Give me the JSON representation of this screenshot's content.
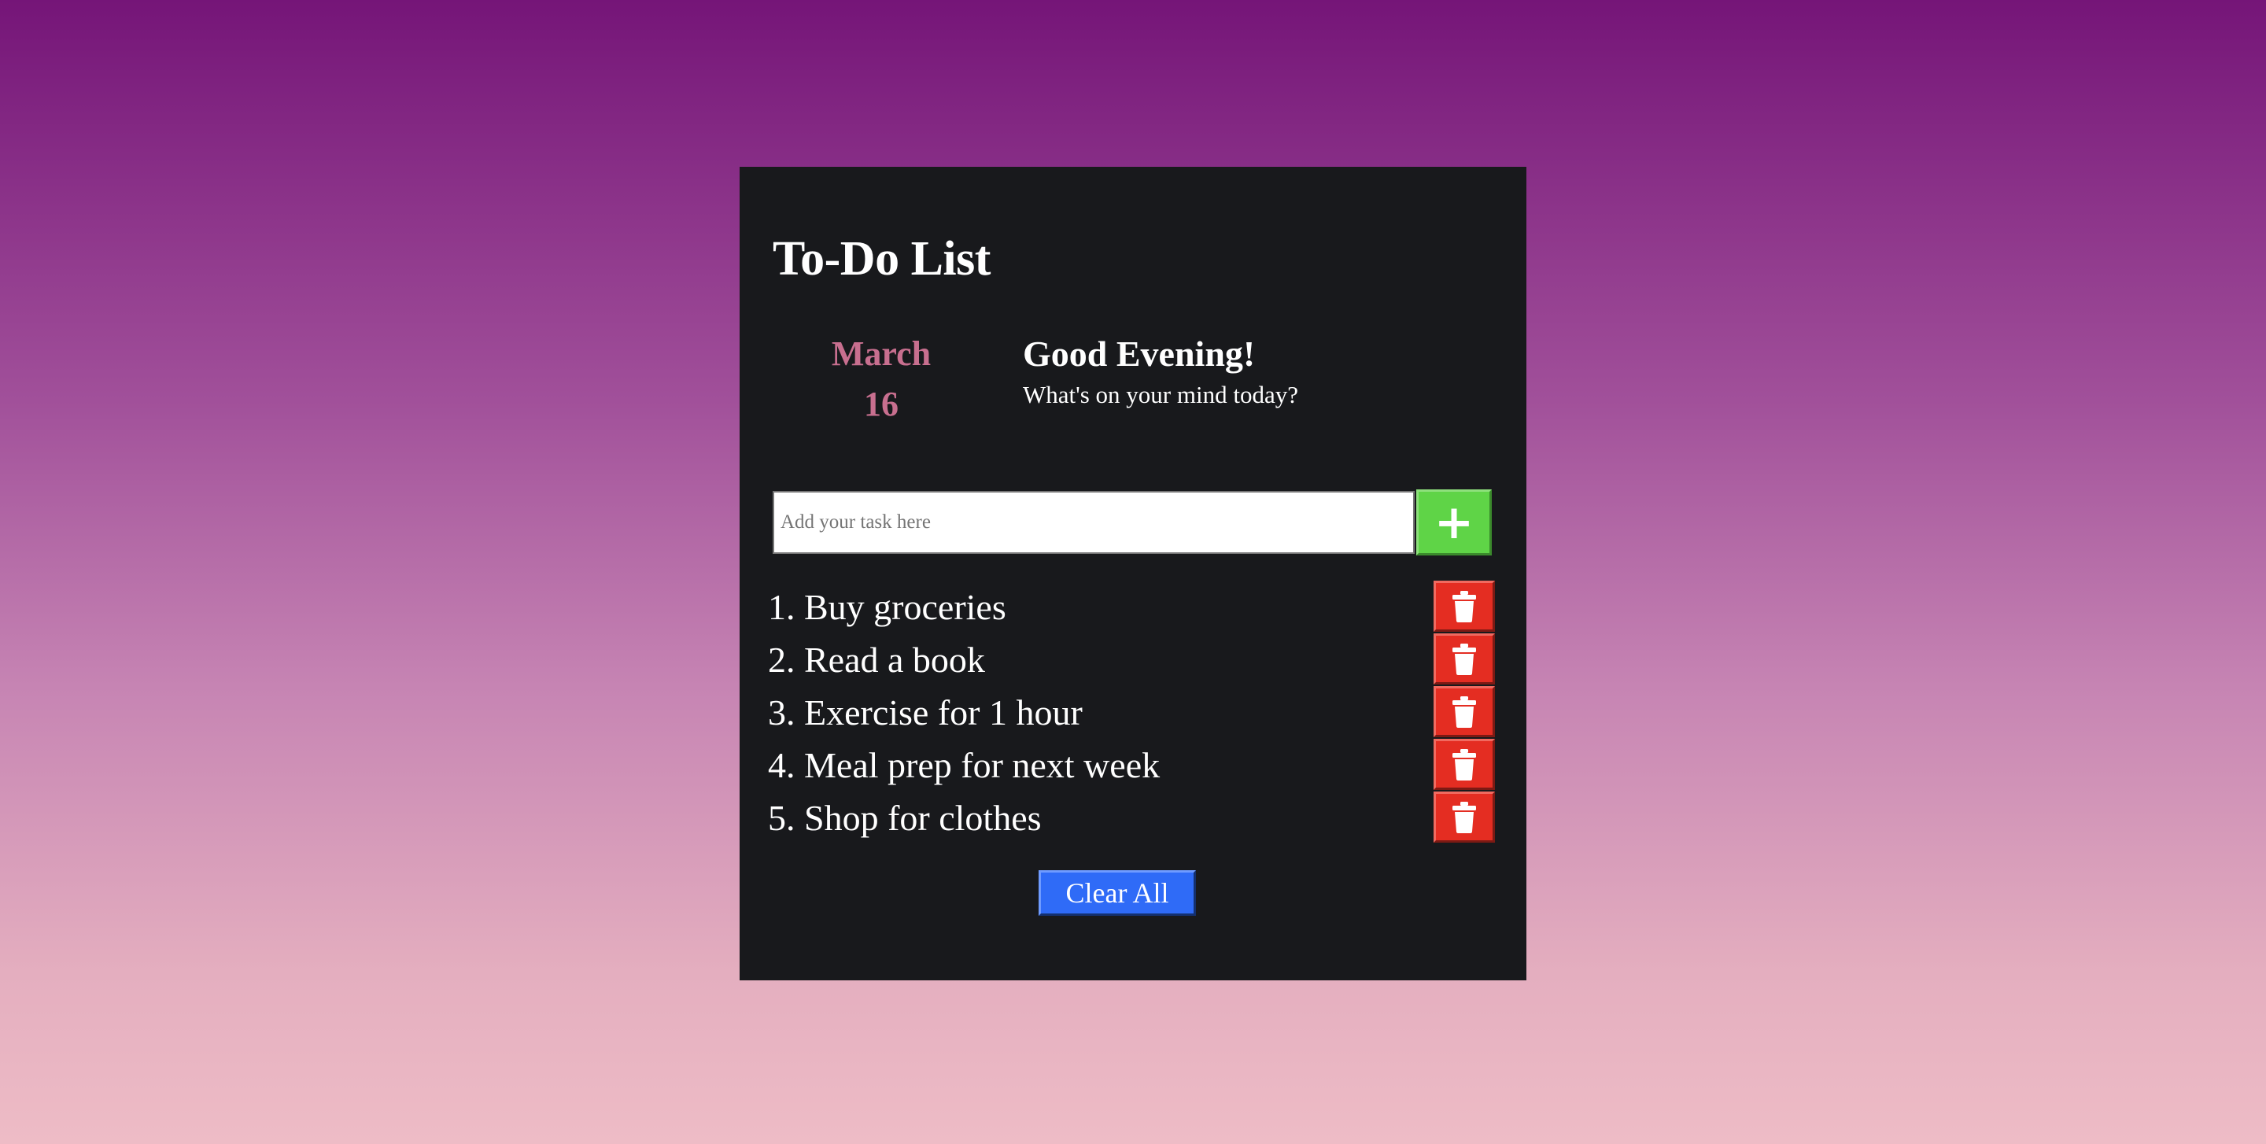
{
  "app": {
    "title": "To-Do List"
  },
  "date": {
    "month": "March",
    "day": "16"
  },
  "greeting": {
    "headline": "Good Evening!",
    "subtitle": "What's on your mind today?"
  },
  "input": {
    "placeholder": "Add your task here",
    "value": "",
    "add_label": "+"
  },
  "tasks": [
    {
      "number": "1.",
      "text": "Buy groceries",
      "delete_icon": "trash-icon"
    },
    {
      "number": "2.",
      "text": "Read a book",
      "delete_icon": "trash-icon"
    },
    {
      "number": "3.",
      "text": "Exercise for 1 hour",
      "delete_icon": "trash-icon"
    },
    {
      "number": "4.",
      "text": "Meal prep for next week",
      "delete_icon": "trash-icon"
    },
    {
      "number": "5.",
      "text": "Shop for clothes",
      "delete_icon": "trash-icon"
    }
  ],
  "actions": {
    "clear_all_label": "Clear All"
  },
  "colors": {
    "card_background": "#18191c",
    "date_accent": "#c86f8f",
    "add_button": "#5fd447",
    "delete_button": "#e42d22",
    "clear_button": "#2f6bf7"
  }
}
